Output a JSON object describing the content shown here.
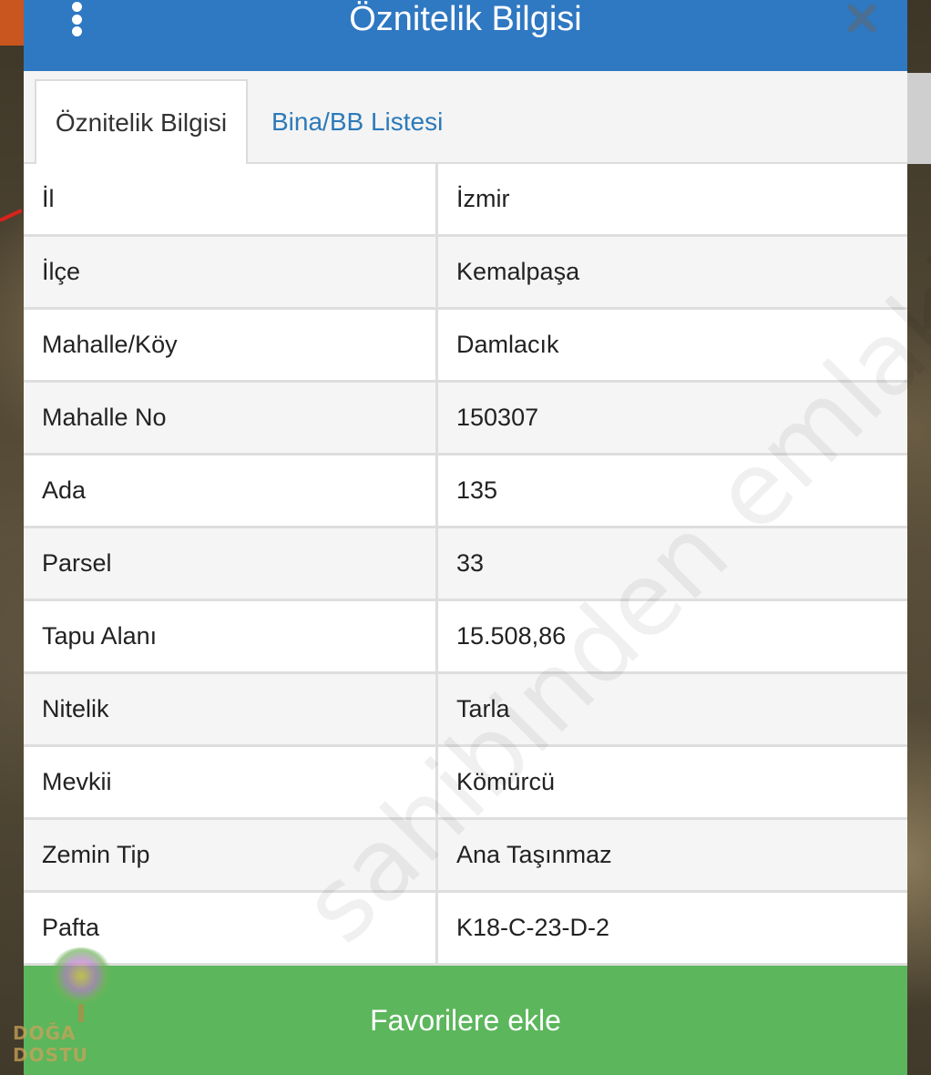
{
  "header": {
    "title": "Öznitelik Bilgisi"
  },
  "tabs": [
    {
      "label": "Öznitelik Bilgisi",
      "active": true
    },
    {
      "label": "Bina/BB Listesi",
      "active": false
    }
  ],
  "attributes": [
    {
      "key": "İl",
      "value": "İzmir"
    },
    {
      "key": "İlçe",
      "value": "Kemalpaşa"
    },
    {
      "key": "Mahalle/Köy",
      "value": "Damlacık"
    },
    {
      "key": "Mahalle No",
      "value": "150307"
    },
    {
      "key": "Ada",
      "value": "135"
    },
    {
      "key": "Parsel",
      "value": "33"
    },
    {
      "key": "Tapu Alanı",
      "value": "15.508,86"
    },
    {
      "key": "Nitelik",
      "value": "Tarla"
    },
    {
      "key": "Mevkii",
      "value": "Kömürcü"
    },
    {
      "key": "Zemin Tip",
      "value": "Ana Taşınmaz"
    },
    {
      "key": "Pafta",
      "value": "K18-C-23-D-2"
    }
  ],
  "footer": {
    "favorite_label": "Favorilere ekle"
  },
  "watermark": {
    "text": "sahibinden emlakjet.com"
  },
  "logo": {
    "name": "DOĞA DOSTU"
  },
  "colors": {
    "header": "#2f78c2",
    "tab_link": "#2c7ab9",
    "favorite_button": "#5cb65c"
  }
}
